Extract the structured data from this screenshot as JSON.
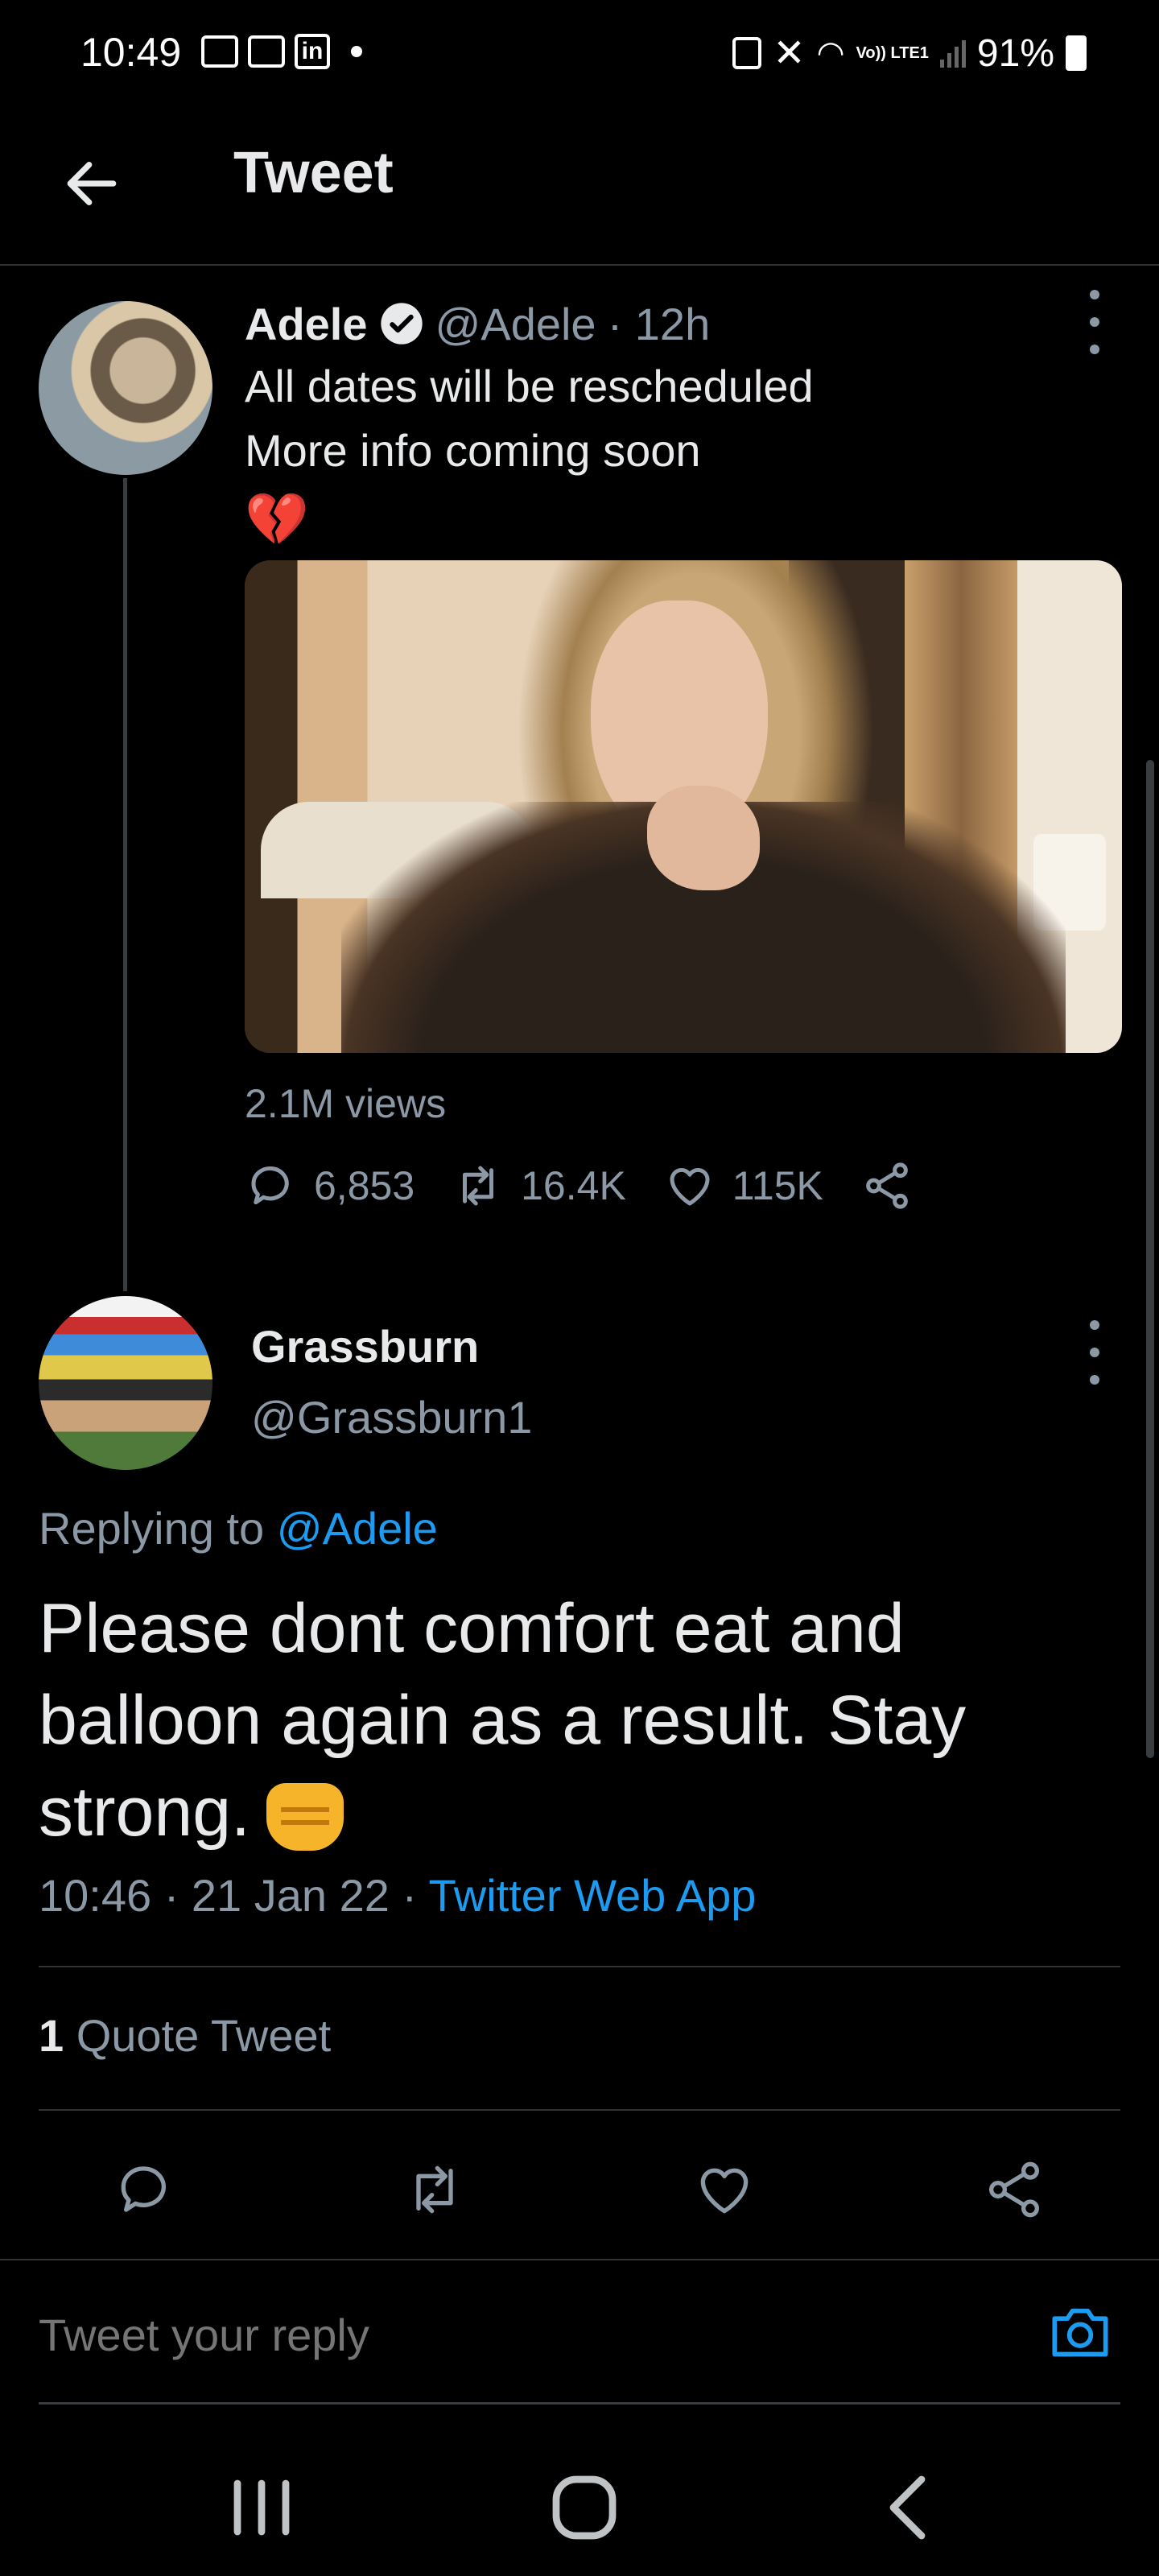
{
  "status_bar": {
    "time": "10:49",
    "left_icons": [
      "outlook-icon",
      "calendar-icon",
      "linkedin-icon",
      "notification-dot"
    ],
    "linkedin_label": "in",
    "lte_label": "Vo)) LTE1",
    "battery": "91%"
  },
  "header": {
    "title": "Tweet"
  },
  "tweet": {
    "name": "Adele",
    "handle": "@Adele",
    "time": "· 12h",
    "line1": "All dates will be rescheduled",
    "line2": "More info coming soon",
    "emoji": "💔",
    "views": "2.1M views",
    "replies": "6,853",
    "retweets": "16.4K",
    "likes": "115K"
  },
  "reply": {
    "name": "Grassburn",
    "handle": "@Grassburn1",
    "replying_prefix": "Replying to ",
    "replying_mention": "@Adele",
    "text": "Please dont comfort eat and balloon again as a result. Stay strong.",
    "meta": "10:46 · 21 Jan 22 · ",
    "source": "Twitter Web App",
    "quote_count": "1",
    "quote_label": " Quote Tweet"
  },
  "composer": {
    "placeholder": "Tweet your reply"
  },
  "colors": {
    "background": "#000000",
    "link": "#1d9bf0",
    "secondary_text": "#8b98a5",
    "divider": "#2f3336"
  }
}
